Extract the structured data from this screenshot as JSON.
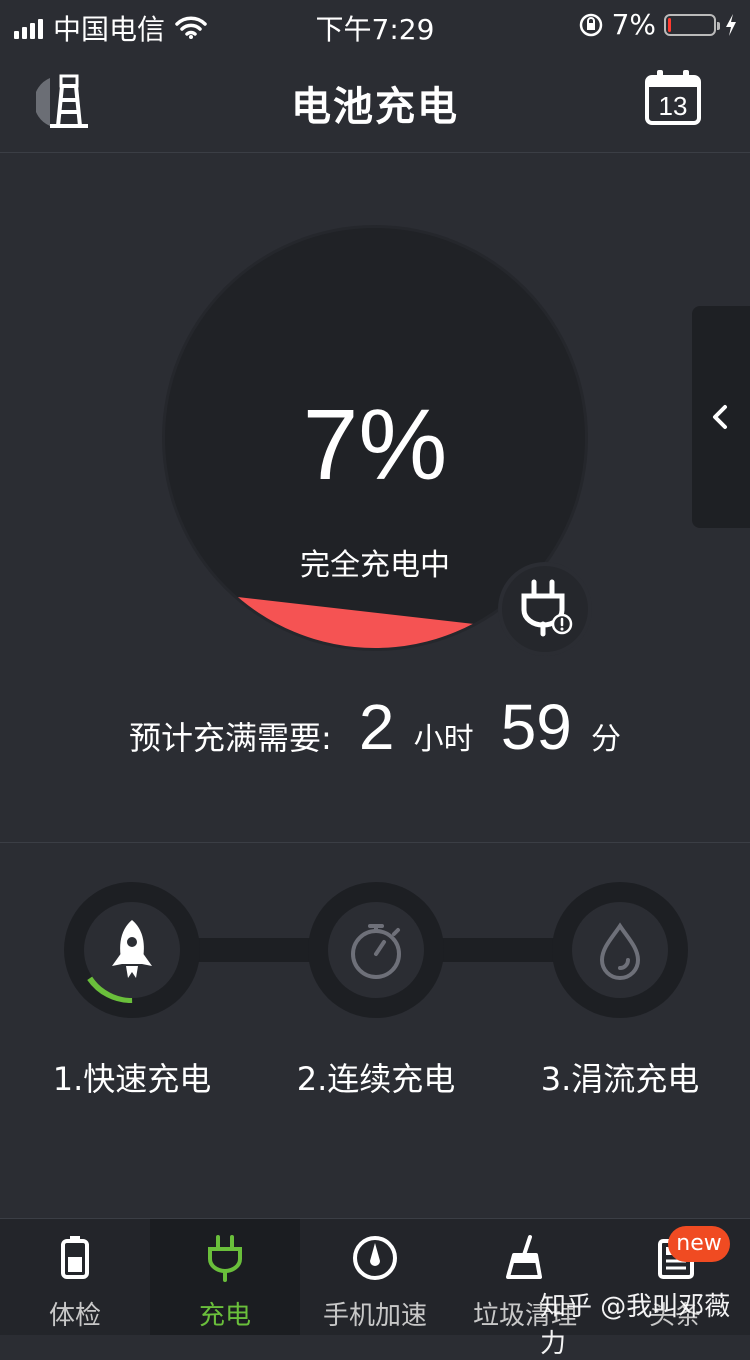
{
  "status_bar": {
    "carrier": "中国电信",
    "time": "下午7:29",
    "battery_text": "7%",
    "battery_level": 0.07
  },
  "header": {
    "title": "电池充电",
    "calendar_day": "13"
  },
  "battery": {
    "percent_text": "7%",
    "level": 0.07,
    "status_text": "完全充电中",
    "fill_color": "#f55353"
  },
  "estimate": {
    "label": "预计充满需要:",
    "hours": "2",
    "hours_unit": "小时",
    "minutes": "59",
    "minutes_unit": "分"
  },
  "steps": [
    {
      "label": "1.快速充电",
      "icon": "rocket-icon",
      "active": true
    },
    {
      "label": "2.连续充电",
      "icon": "stopwatch-icon",
      "active": false
    },
    {
      "label": "3.涓流充电",
      "icon": "water-drop-icon",
      "active": false
    }
  ],
  "accent_color": "#6abf3b",
  "tabbar": [
    {
      "label": "体检",
      "icon": "battery-icon",
      "active": false
    },
    {
      "label": "充电",
      "icon": "plug-icon",
      "active": true
    },
    {
      "label": "手机加速",
      "icon": "speedometer-icon",
      "active": false
    },
    {
      "label": "垃圾清理",
      "icon": "broom-icon",
      "active": false
    },
    {
      "label": "头条",
      "icon": "news-icon",
      "active": false
    }
  ],
  "new_badge": "new",
  "watermark": "知乎 @我叫邓薇力"
}
